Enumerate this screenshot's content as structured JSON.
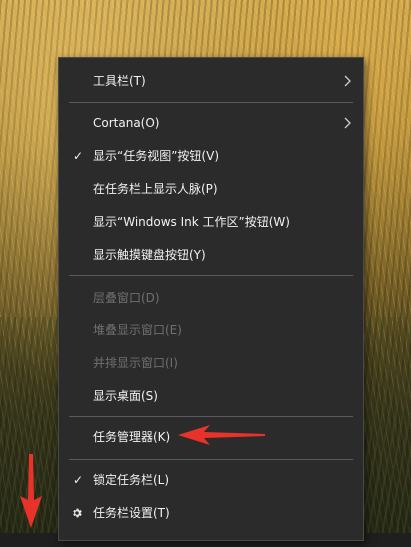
{
  "context_menu": {
    "items": [
      {
        "label": "工具栏(T)",
        "enabled": true,
        "submenu": true
      },
      {
        "label": "Cortana(O)",
        "enabled": true,
        "submenu": true
      },
      {
        "label": "显示“任务视图”按钮(V)",
        "enabled": true,
        "checked": true
      },
      {
        "label": "在任务栏上显示人脉(P)",
        "enabled": true
      },
      {
        "label": "显示“Windows Ink 工作区”按钮(W)",
        "enabled": true
      },
      {
        "label": "显示触摸键盘按钮(Y)",
        "enabled": true
      },
      {
        "label": "层叠窗口(D)",
        "enabled": false
      },
      {
        "label": "堆叠显示窗口(E)",
        "enabled": false
      },
      {
        "label": "并排显示窗口(I)",
        "enabled": false
      },
      {
        "label": "显示桌面(S)",
        "enabled": true
      },
      {
        "label": "任务管理器(K)",
        "enabled": true
      },
      {
        "label": "锁定任务栏(L)",
        "enabled": true,
        "checked": true
      },
      {
        "label": "任务栏设置(T)",
        "enabled": true,
        "icon": "gear-icon"
      }
    ]
  },
  "annotations": {
    "arrow_color": "#e8322a"
  }
}
